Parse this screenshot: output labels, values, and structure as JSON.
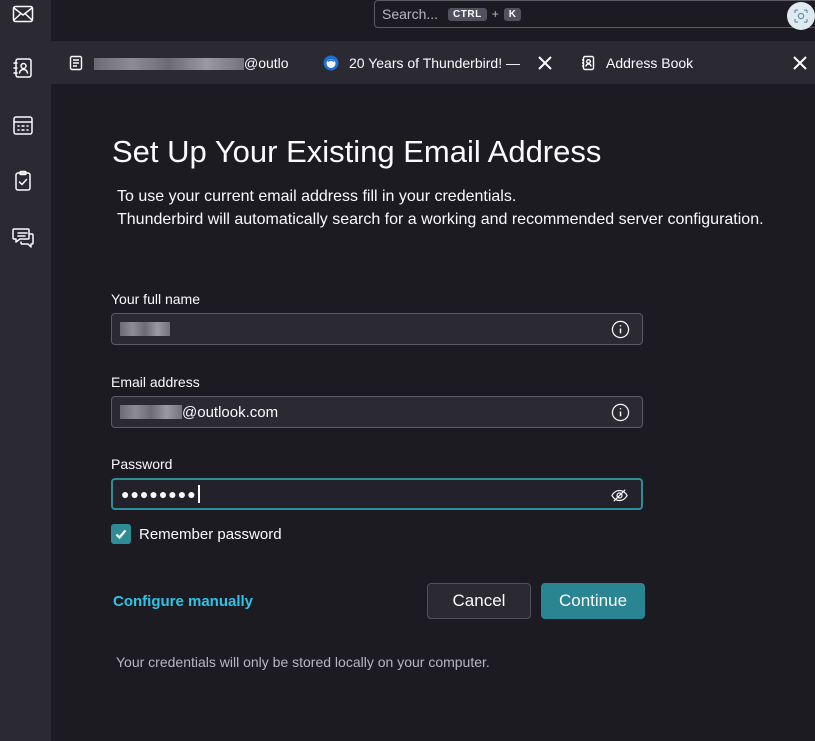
{
  "spaces": [
    {
      "name": "mail-space-button",
      "icon": "envelope-icon"
    },
    {
      "name": "address-book-space-button",
      "icon": "address-book-icon"
    },
    {
      "name": "calendar-space-button",
      "icon": "calendar-icon"
    },
    {
      "name": "tasks-space-button",
      "icon": "clipboard-check-icon"
    },
    {
      "name": "chat-space-button",
      "icon": "chat-bubbles-icon"
    }
  ],
  "search": {
    "placeholder": "Search...",
    "shortcut_mod": "CTRL",
    "shortcut_plus": "+",
    "shortcut_key": "K"
  },
  "tabs": [
    {
      "label_suffix": "@outlo",
      "icon": "mailbox-icon",
      "label_redacted": true
    },
    {
      "label": "20 Years of Thunderbird! —",
      "icon": "thunderbird-logo-icon",
      "closable": true
    },
    {
      "label": "Address Book",
      "icon": "address-book-icon",
      "closable": true
    }
  ],
  "setup": {
    "title": "Set Up Your Existing Email Address",
    "desc_line1": "To use your current email address fill in your credentials.",
    "desc_line2": "Thunderbird will automatically search for a working and recommended server configuration.",
    "name_label": "Your full name",
    "email_label": "Email address",
    "email_value_suffix": "@outlook.com",
    "password_label": "Password",
    "password_mask": "●●●●●●●●",
    "remember_label": "Remember password",
    "remember_checked": true,
    "configure_manually": "Configure manually",
    "cancel": "Cancel",
    "continue": "Continue",
    "footnote": "Your credentials will only be stored locally on your computer."
  },
  "colors": {
    "accent": "#2a8592",
    "link": "#2ec4e6",
    "background": "#1c1b22",
    "sidebar": "#2b2a33"
  }
}
